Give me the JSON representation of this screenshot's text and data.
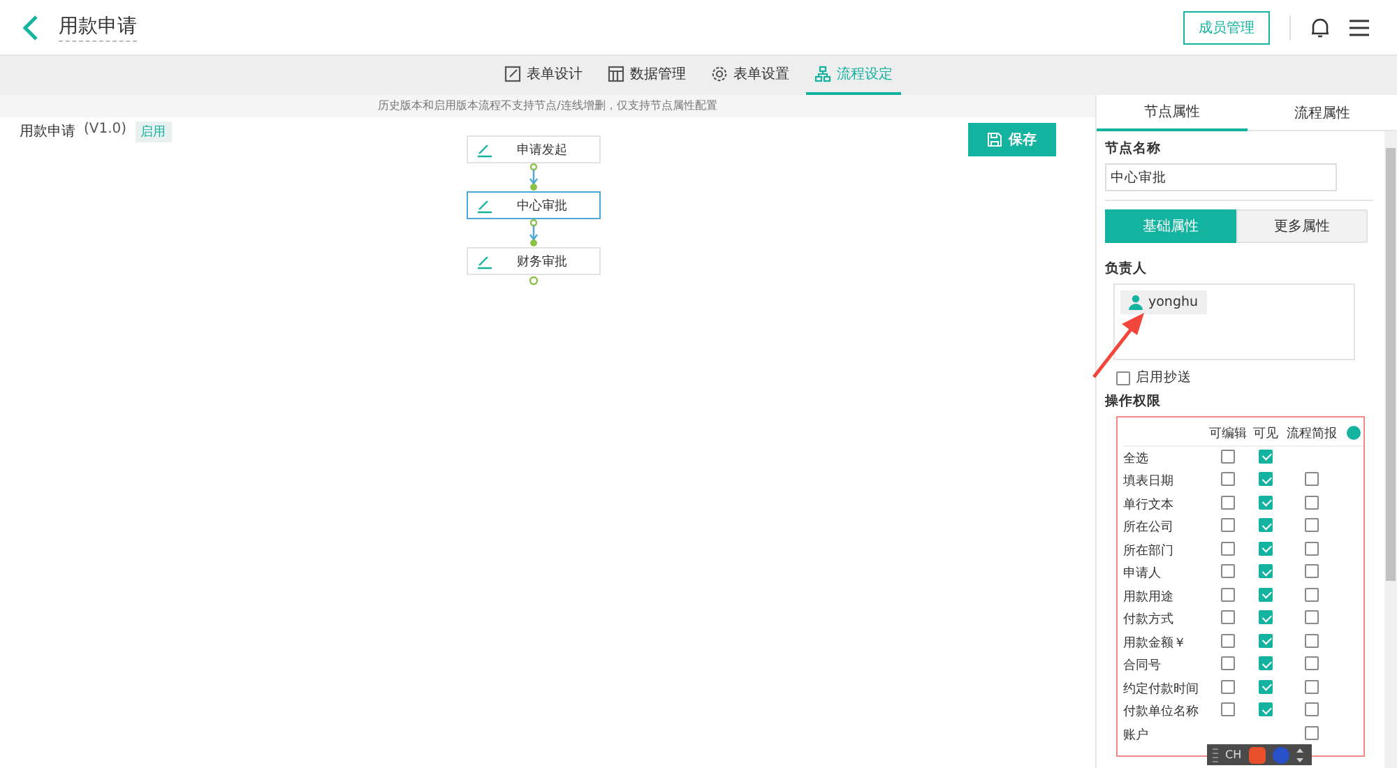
{
  "header": {
    "title": "用款申请",
    "member_button": "成员管理"
  },
  "tabs": [
    {
      "label": "表单设计",
      "kind": "edit",
      "selected": false
    },
    {
      "label": "数据管理",
      "kind": "table",
      "selected": false
    },
    {
      "label": "表单设置",
      "kind": "gear",
      "selected": false
    },
    {
      "label": "流程设定",
      "kind": "flow",
      "selected": true
    }
  ],
  "notice": "历史版本和启用版本流程不支持节点/连线增删，仅支持节点属性配置",
  "flow": {
    "name": "用款申请",
    "version": "(V1.0)",
    "status": "启用",
    "save_button": "保存",
    "nodes": [
      {
        "label": "申请发起",
        "selected": false
      },
      {
        "label": "中心审批",
        "selected": true
      },
      {
        "label": "财务审批",
        "selected": false
      }
    ]
  },
  "panel": {
    "tabs": [
      {
        "label": "节点属性",
        "selected": true
      },
      {
        "label": "流程属性",
        "selected": false
      }
    ],
    "node_name_label": "节点名称",
    "node_name": "中心审批",
    "sub_tabs": [
      {
        "label": "基础属性",
        "selected": true
      },
      {
        "label": "更多属性",
        "selected": false
      }
    ],
    "owner_label": "负责人",
    "owner": "yonghu",
    "cc": {
      "label": "启用抄送",
      "checked": false
    },
    "perm_label": "操作权限",
    "columns": [
      "可编辑",
      "可见",
      "流程简报"
    ],
    "rows": [
      {
        "label": "全选",
        "editable": false,
        "visible": true
      },
      {
        "label": "填表日期",
        "editable": false,
        "visible": true,
        "report": false
      },
      {
        "label": "单行文本",
        "editable": false,
        "visible": true,
        "report": false
      },
      {
        "label": "所在公司",
        "editable": false,
        "visible": true,
        "report": false
      },
      {
        "label": "所在部门",
        "editable": false,
        "visible": true,
        "report": false
      },
      {
        "label": "申请人",
        "editable": false,
        "visible": true,
        "report": false
      },
      {
        "label": "用款用途",
        "editable": false,
        "visible": true,
        "report": false
      },
      {
        "label": "付款方式",
        "editable": false,
        "visible": true,
        "report": false
      },
      {
        "label": "用款金额￥",
        "editable": false,
        "visible": true,
        "report": false
      },
      {
        "label": "合同号",
        "editable": false,
        "visible": true,
        "report": false
      },
      {
        "label": "约定付款时间",
        "editable": false,
        "visible": true,
        "report": false
      },
      {
        "label": "付款单位名称",
        "editable": false,
        "visible": true,
        "report": false
      },
      {
        "label": "账户",
        "report": false
      }
    ]
  },
  "ime": {
    "label": "CH"
  }
}
